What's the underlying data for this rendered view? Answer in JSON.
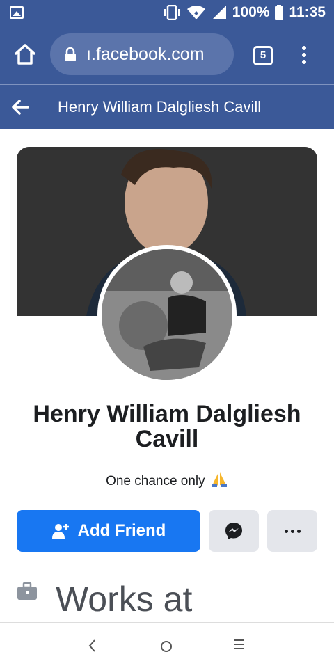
{
  "status_bar": {
    "battery": "100%",
    "time": "11:35"
  },
  "browser": {
    "url": "ı.facebook.com",
    "tab_count": "5"
  },
  "header": {
    "title": "Henry William Dalgliesh Cavill"
  },
  "profile": {
    "name": "Henry William Dalgliesh Cavill",
    "bio": "One chance only"
  },
  "actions": {
    "add_friend_label": "Add Friend"
  },
  "about": {
    "works_at": "Works at"
  },
  "colors": {
    "fb_blue": "#3b5998",
    "button_blue": "#1877f2",
    "button_gray": "#e4e6eb"
  }
}
